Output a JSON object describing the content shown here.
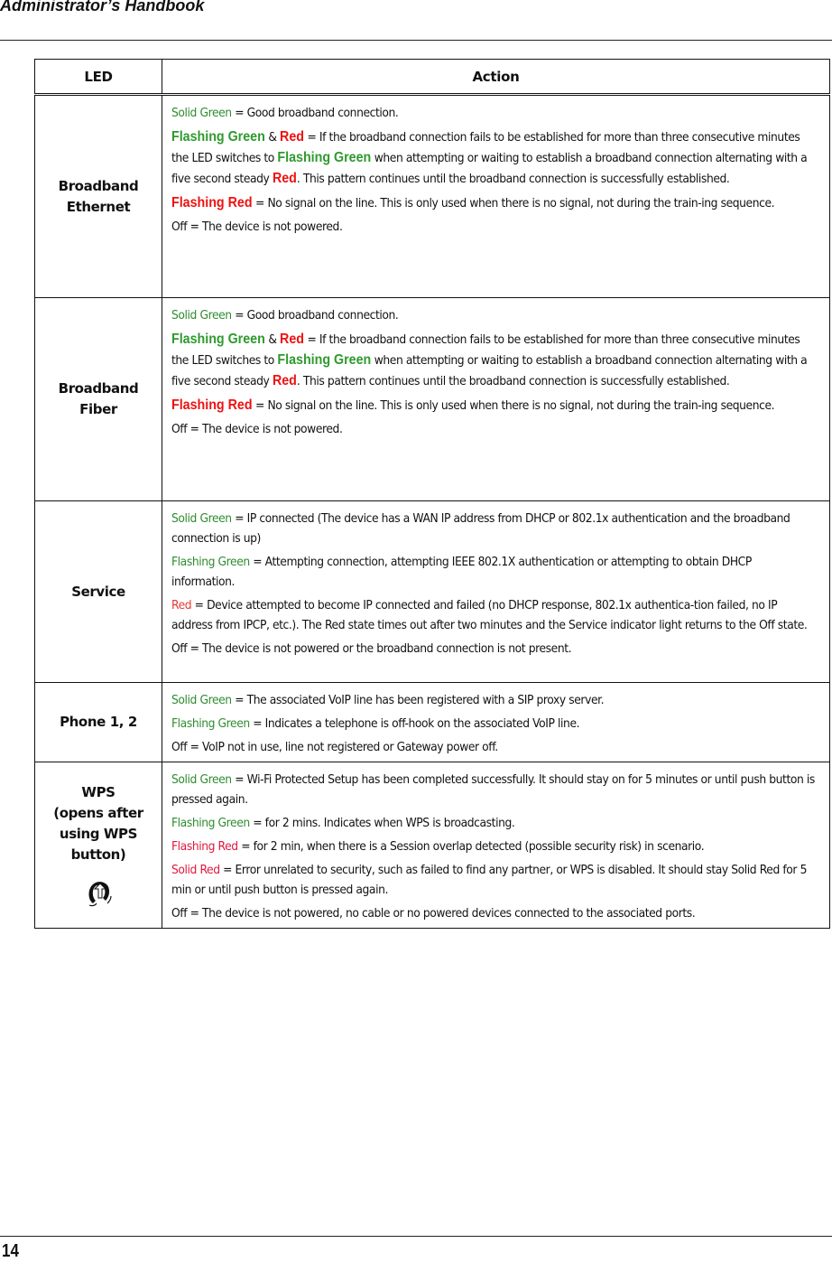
{
  "header": {
    "title": "Administrator’s Handbook"
  },
  "footer": {
    "page_number": "14"
  },
  "colors": {
    "green": "#2e8b2e",
    "red": "#e53935",
    "crimson": "#e0183c"
  },
  "table": {
    "columns": [
      "LED",
      "Action"
    ],
    "rows": [
      {
        "led": [
          "Broadband",
          "Ethernet"
        ],
        "actions": [
          {
            "key": "Solid Green",
            "style": "green",
            "text": " = Good broadband connection."
          },
          {
            "parts": [
              {
                "t": "Flashing Green",
                "s": "bold-green"
              },
              {
                "t": " & ",
                "s": "plain"
              },
              {
                "t": "Red",
                "s": "bold-red"
              },
              {
                "t": " = If the broadband connection fails to be established for more than three consecutive minutes the LED switches to ",
                "s": "plain"
              },
              {
                "t": "Flashing Green",
                "s": "bold-green"
              },
              {
                "t": " when attempting or waiting to establish a broadband connection alternating with a five second steady ",
                "s": "plain"
              },
              {
                "t": "Red",
                "s": "bold-red"
              },
              {
                "t": ". This pattern continues until the broadband connection is successfully established.",
                "s": "plain"
              }
            ]
          },
          {
            "key": "Flashing Red",
            "style": "bold-red",
            "text": " = No signal on the line. This is only used when there is no signal, not during the train-ing sequence."
          },
          {
            "key": "",
            "style": "plain",
            "text": "Off = The device is not powered."
          }
        ]
      },
      {
        "led": [
          "Broadband",
          "Fiber"
        ],
        "actions": [
          {
            "key": "Solid Green",
            "style": "green",
            "text": " = Good broadband connection."
          },
          {
            "parts": [
              {
                "t": "Flashing Green",
                "s": "bold-green"
              },
              {
                "t": " & ",
                "s": "plain"
              },
              {
                "t": "Red",
                "s": "bold-red"
              },
              {
                "t": " = If the broadband connection fails to be established for more than three consecutive minutes the LED switches to ",
                "s": "plain"
              },
              {
                "t": "Flashing Green",
                "s": "bold-green"
              },
              {
                "t": " when attempting or waiting to establish a broadband connection alternating with a five second steady ",
                "s": "plain"
              },
              {
                "t": "Red",
                "s": "bold-red"
              },
              {
                "t": ". This pattern continues until the broadband connection is successfully established.",
                "s": "plain"
              }
            ]
          },
          {
            "key": "Flashing Red",
            "style": "bold-red",
            "text": " = No signal on the line. This is only used when there is no signal, not during the train-ing sequence."
          },
          {
            "key": "",
            "style": "plain",
            "text": "Off = The device is not powered."
          }
        ]
      },
      {
        "led": [
          "Service"
        ],
        "actions": [
          {
            "key": "Solid Green",
            "style": "green",
            "text": " = IP connected (The device has a WAN IP address from DHCP or 802.1x authentication and the broadband connection is up)"
          },
          {
            "key": "Flashing Green",
            "style": "green",
            "text": " = Attempting connection, attempting IEEE 802.1X authentication or attempting to obtain DHCP information."
          },
          {
            "key": "Red",
            "style": "red",
            "text": " = Device attempted to become IP connected and failed (no DHCP response, 802.1x authentica-tion failed, no IP address from IPCP, etc.). The Red state times out after two minutes and the Service indicator light returns to the Off state."
          },
          {
            "key": "",
            "style": "plain",
            "text": "Off = The device is not powered or the broadband connection is not present."
          }
        ]
      },
      {
        "led": [
          "Phone 1, 2"
        ],
        "actions": [
          {
            "key": "Solid Green",
            "style": "green",
            "text": " = The associated VoIP line has been registered with a SIP proxy server."
          },
          {
            "key": "Flashing Green",
            "style": "green",
            "text": " = Indicates a telephone is off-hook on the associated VoIP line."
          },
          {
            "key": "",
            "style": "plain",
            "text": "Off = VoIP not in use, line not registered or Gateway power off."
          }
        ]
      },
      {
        "led": [
          "WPS",
          "(opens after",
          "using WPS",
          "button)"
        ],
        "icon": "wps-icon",
        "actions": [
          {
            "key": "Solid Green",
            "style": "green",
            "text": " = Wi-Fi Protected Setup has been completed successfully. It should stay on for 5 minutes or until push button is pressed again."
          },
          {
            "key": "Flashing Green",
            "style": "green",
            "text": " = for 2 mins. Indicates when WPS is broadcasting."
          },
          {
            "key": "Flashing Red",
            "style": "crimson",
            "text": " = for 2 min, when there is a Session overlap detected (possible security risk) in scenario."
          },
          {
            "key": "Solid Red",
            "style": "crimson",
            "text": " = Error unrelated to security, such as failed to find any partner, or WPS is disabled. It should stay Solid Red for 5 min or until push button is pressed again."
          },
          {
            "key": "",
            "style": "plain",
            "text": "Off = The device is not powered, no cable or no powered devices connected to the associated ports."
          }
        ]
      }
    ]
  }
}
